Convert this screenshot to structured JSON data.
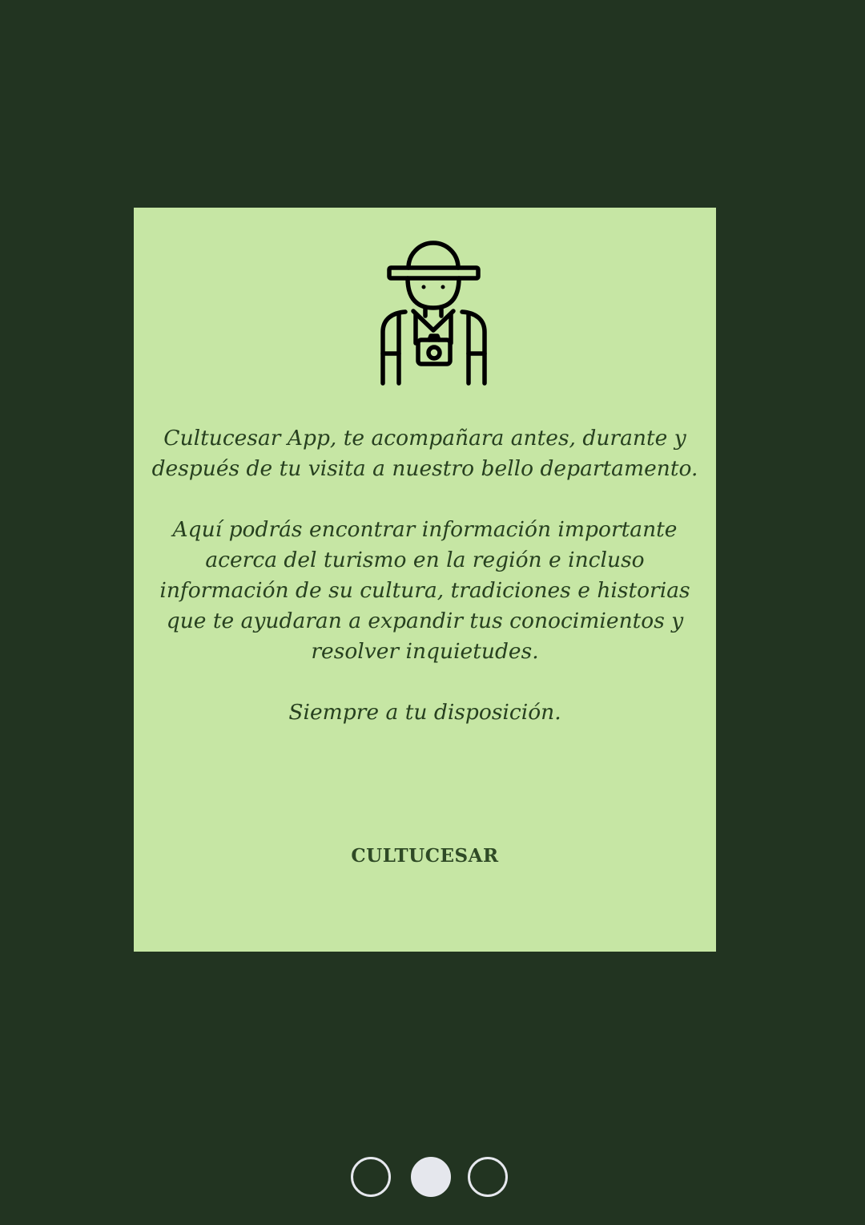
{
  "intro": {
    "icon": "explorer-with-camera-icon",
    "paragraphs": [
      "Cultucesar App, te acompañara antes, durante y después de tu visita a nuestro bello departamento.",
      "Aquí podrás encontrar información importante acerca del turismo en la región e incluso información de su cultura, tradiciones e historias que te ayudaran a expandir tus conocimientos y resolver inquietudes.",
      "Siempre a tu disposición."
    ],
    "signature": "CULTUCESAR"
  },
  "pager": {
    "pages": 3,
    "current_page": 2
  },
  "colors": {
    "background": "#223421",
    "card": "#c6e6a4",
    "text": "#27401f",
    "dot": "#e5e7ed"
  }
}
